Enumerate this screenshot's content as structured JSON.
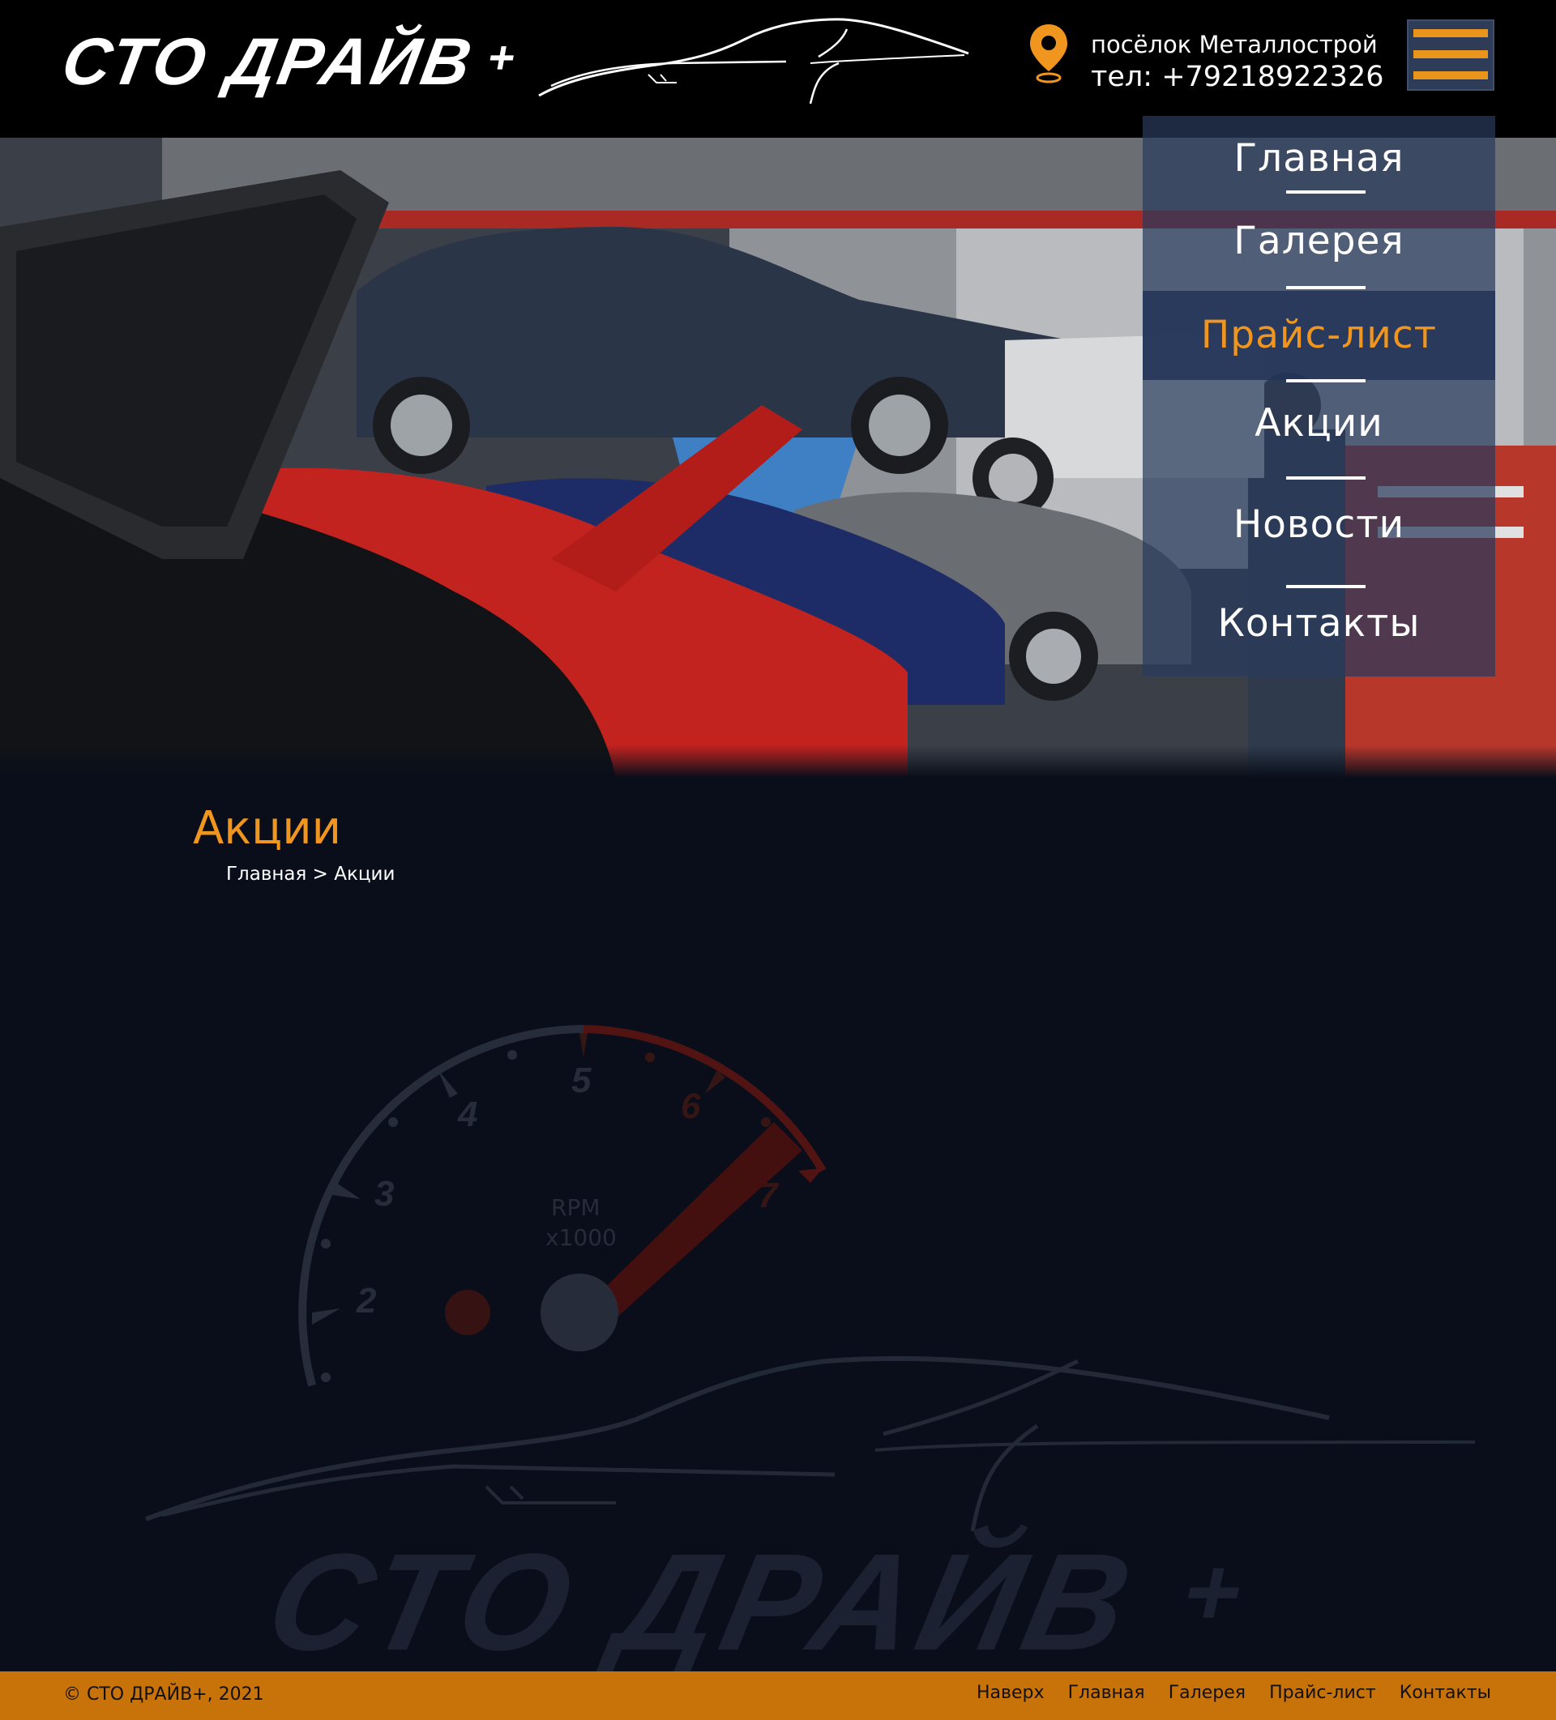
{
  "header": {
    "logo_text": "СТО ДРАЙВ",
    "logo_plus": "+",
    "address": "посёлок Металлострой",
    "phone": "тел: +79218922326"
  },
  "menu": {
    "items": [
      {
        "label": "Главная",
        "active": false
      },
      {
        "label": "Галерея",
        "active": false
      },
      {
        "label": "Прайс-лист",
        "active": true
      },
      {
        "label": "Акции",
        "active": false
      },
      {
        "label": "Новости",
        "active": false
      },
      {
        "label": "Контакты",
        "active": false
      }
    ]
  },
  "page": {
    "title": "Акции",
    "breadcrumb": {
      "home": "Главная",
      "separator": ">",
      "current": "Акции"
    }
  },
  "watermark": {
    "gauge_labels": [
      "2",
      "3",
      "4",
      "5",
      "6",
      "7"
    ],
    "gauge_unit_1": "RPM",
    "gauge_unit_2": "x1000",
    "logo_text": "СТО ДРАЙВ",
    "logo_plus": "+"
  },
  "footer": {
    "copyright": "© СТО ДРАЙВ+, 2021",
    "links": [
      "Наверх",
      "Главная",
      "Галерея",
      "Прайс-лист",
      "Контакты"
    ]
  },
  "colors": {
    "accent": "#f0961e",
    "footer_bg": "#c8720a",
    "page_bg": "#090e1a",
    "menu_bg": "#283a5c"
  }
}
